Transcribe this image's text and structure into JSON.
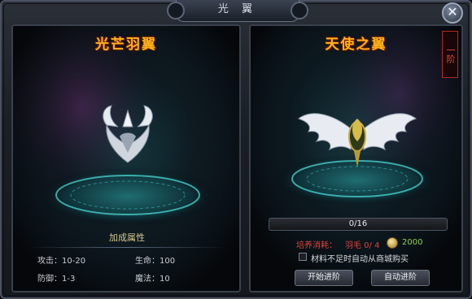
{
  "window": {
    "title": "光 翼",
    "close_glyph": "✕"
  },
  "left_panel": {
    "title": "光芒羽翼",
    "stats_title": "加成属性",
    "stats": [
      {
        "label": "攻击",
        "sep": "：",
        "value": "10-20"
      },
      {
        "label": "生命",
        "sep": "：",
        "value": "100"
      },
      {
        "label": "防御",
        "sep": "：",
        "value": "1-3"
      },
      {
        "label": "魔法",
        "sep": "：",
        "value": "10"
      }
    ]
  },
  "right_panel": {
    "title": "天使之翼",
    "tier": "一阶",
    "progress": {
      "text": "0/16",
      "current": 0,
      "max": 16
    },
    "cost": {
      "label": "培养消耗：",
      "item": "羽毛 0/ 4",
      "gold": "2000"
    },
    "auto_buy_label": "材料不足时自动从商城购买",
    "auto_buy_checked": false,
    "buttons": {
      "start": "开始进阶",
      "auto": "自动进阶"
    }
  },
  "colors": {
    "title_gold": "#ffb21a",
    "cost_red": "#e0413a",
    "gold_green": "#8fd14f",
    "ring_cyan": "#3fd2cf"
  },
  "icons": [
    "close-icon",
    "wing-icon",
    "coin-icon",
    "checkbox-icon",
    "platform-ring"
  ]
}
